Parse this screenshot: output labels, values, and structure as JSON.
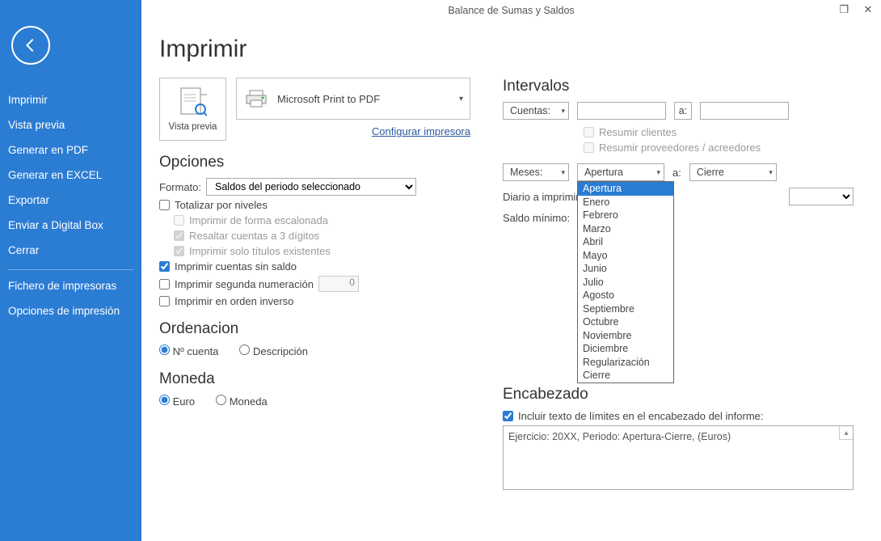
{
  "window": {
    "title": "Balance de Sumas y Saldos"
  },
  "sidebar": {
    "items": [
      "Imprimir",
      "Vista previa",
      "Generar en PDF",
      "Generar en EXCEL",
      "Exportar",
      "Enviar a Digital Box",
      "Cerrar"
    ],
    "items2": [
      "Fichero de impresoras",
      "Opciones de impresión"
    ]
  },
  "page": {
    "title": "Imprimir"
  },
  "preview": {
    "label": "Vista previa"
  },
  "printer": {
    "name": "Microsoft Print to PDF",
    "config_link": "Configurar impresora"
  },
  "options": {
    "title": "Opciones",
    "format_label": "Formato:",
    "format_value": "Saldos del periodo seleccionado",
    "totalize": "Totalizar por niveles",
    "staggered": "Imprimir de forma escalonada",
    "highlight3": "Resaltar cuentas a 3 dígitos",
    "only_titles": "Imprimir solo títulos existentes",
    "empty_bal": "Imprimir cuentas sin saldo",
    "second_num": "Imprimir segunda numeración",
    "second_num_val": "0",
    "reverse": "Imprimir en orden inverso"
  },
  "order": {
    "title": "Ordenacion",
    "by_num": "Nº cuenta",
    "by_desc": "Descripción"
  },
  "currency": {
    "title": "Moneda",
    "euro": "Euro",
    "other": "Moneda"
  },
  "intervals": {
    "title": "Intervalos",
    "accounts_label": "Cuentas:",
    "to_label": "a:",
    "summarize_clients": "Resumir clientes",
    "summarize_suppliers": "Resumir proveedores / acreedores",
    "months_label": "Meses:",
    "month_from": "Apertura",
    "month_to": "Cierre",
    "month_options": [
      "Apertura",
      "Enero",
      "Febrero",
      "Marzo",
      "Abril",
      "Mayo",
      "Junio",
      "Julio",
      "Agosto",
      "Septiembre",
      "Octubre",
      "Noviembre",
      "Diciembre",
      "Regularización",
      "Cierre"
    ],
    "diary_label": "Diario a imprimir:",
    "min_balance_label": "Saldo mínimo:"
  },
  "header": {
    "title": "Encabezado",
    "include_limits": "Incluir texto de límites en el encabezado del informe:",
    "text": "Ejercicio: 20XX, Periodo: Apertura-Cierre, (Euros)"
  }
}
